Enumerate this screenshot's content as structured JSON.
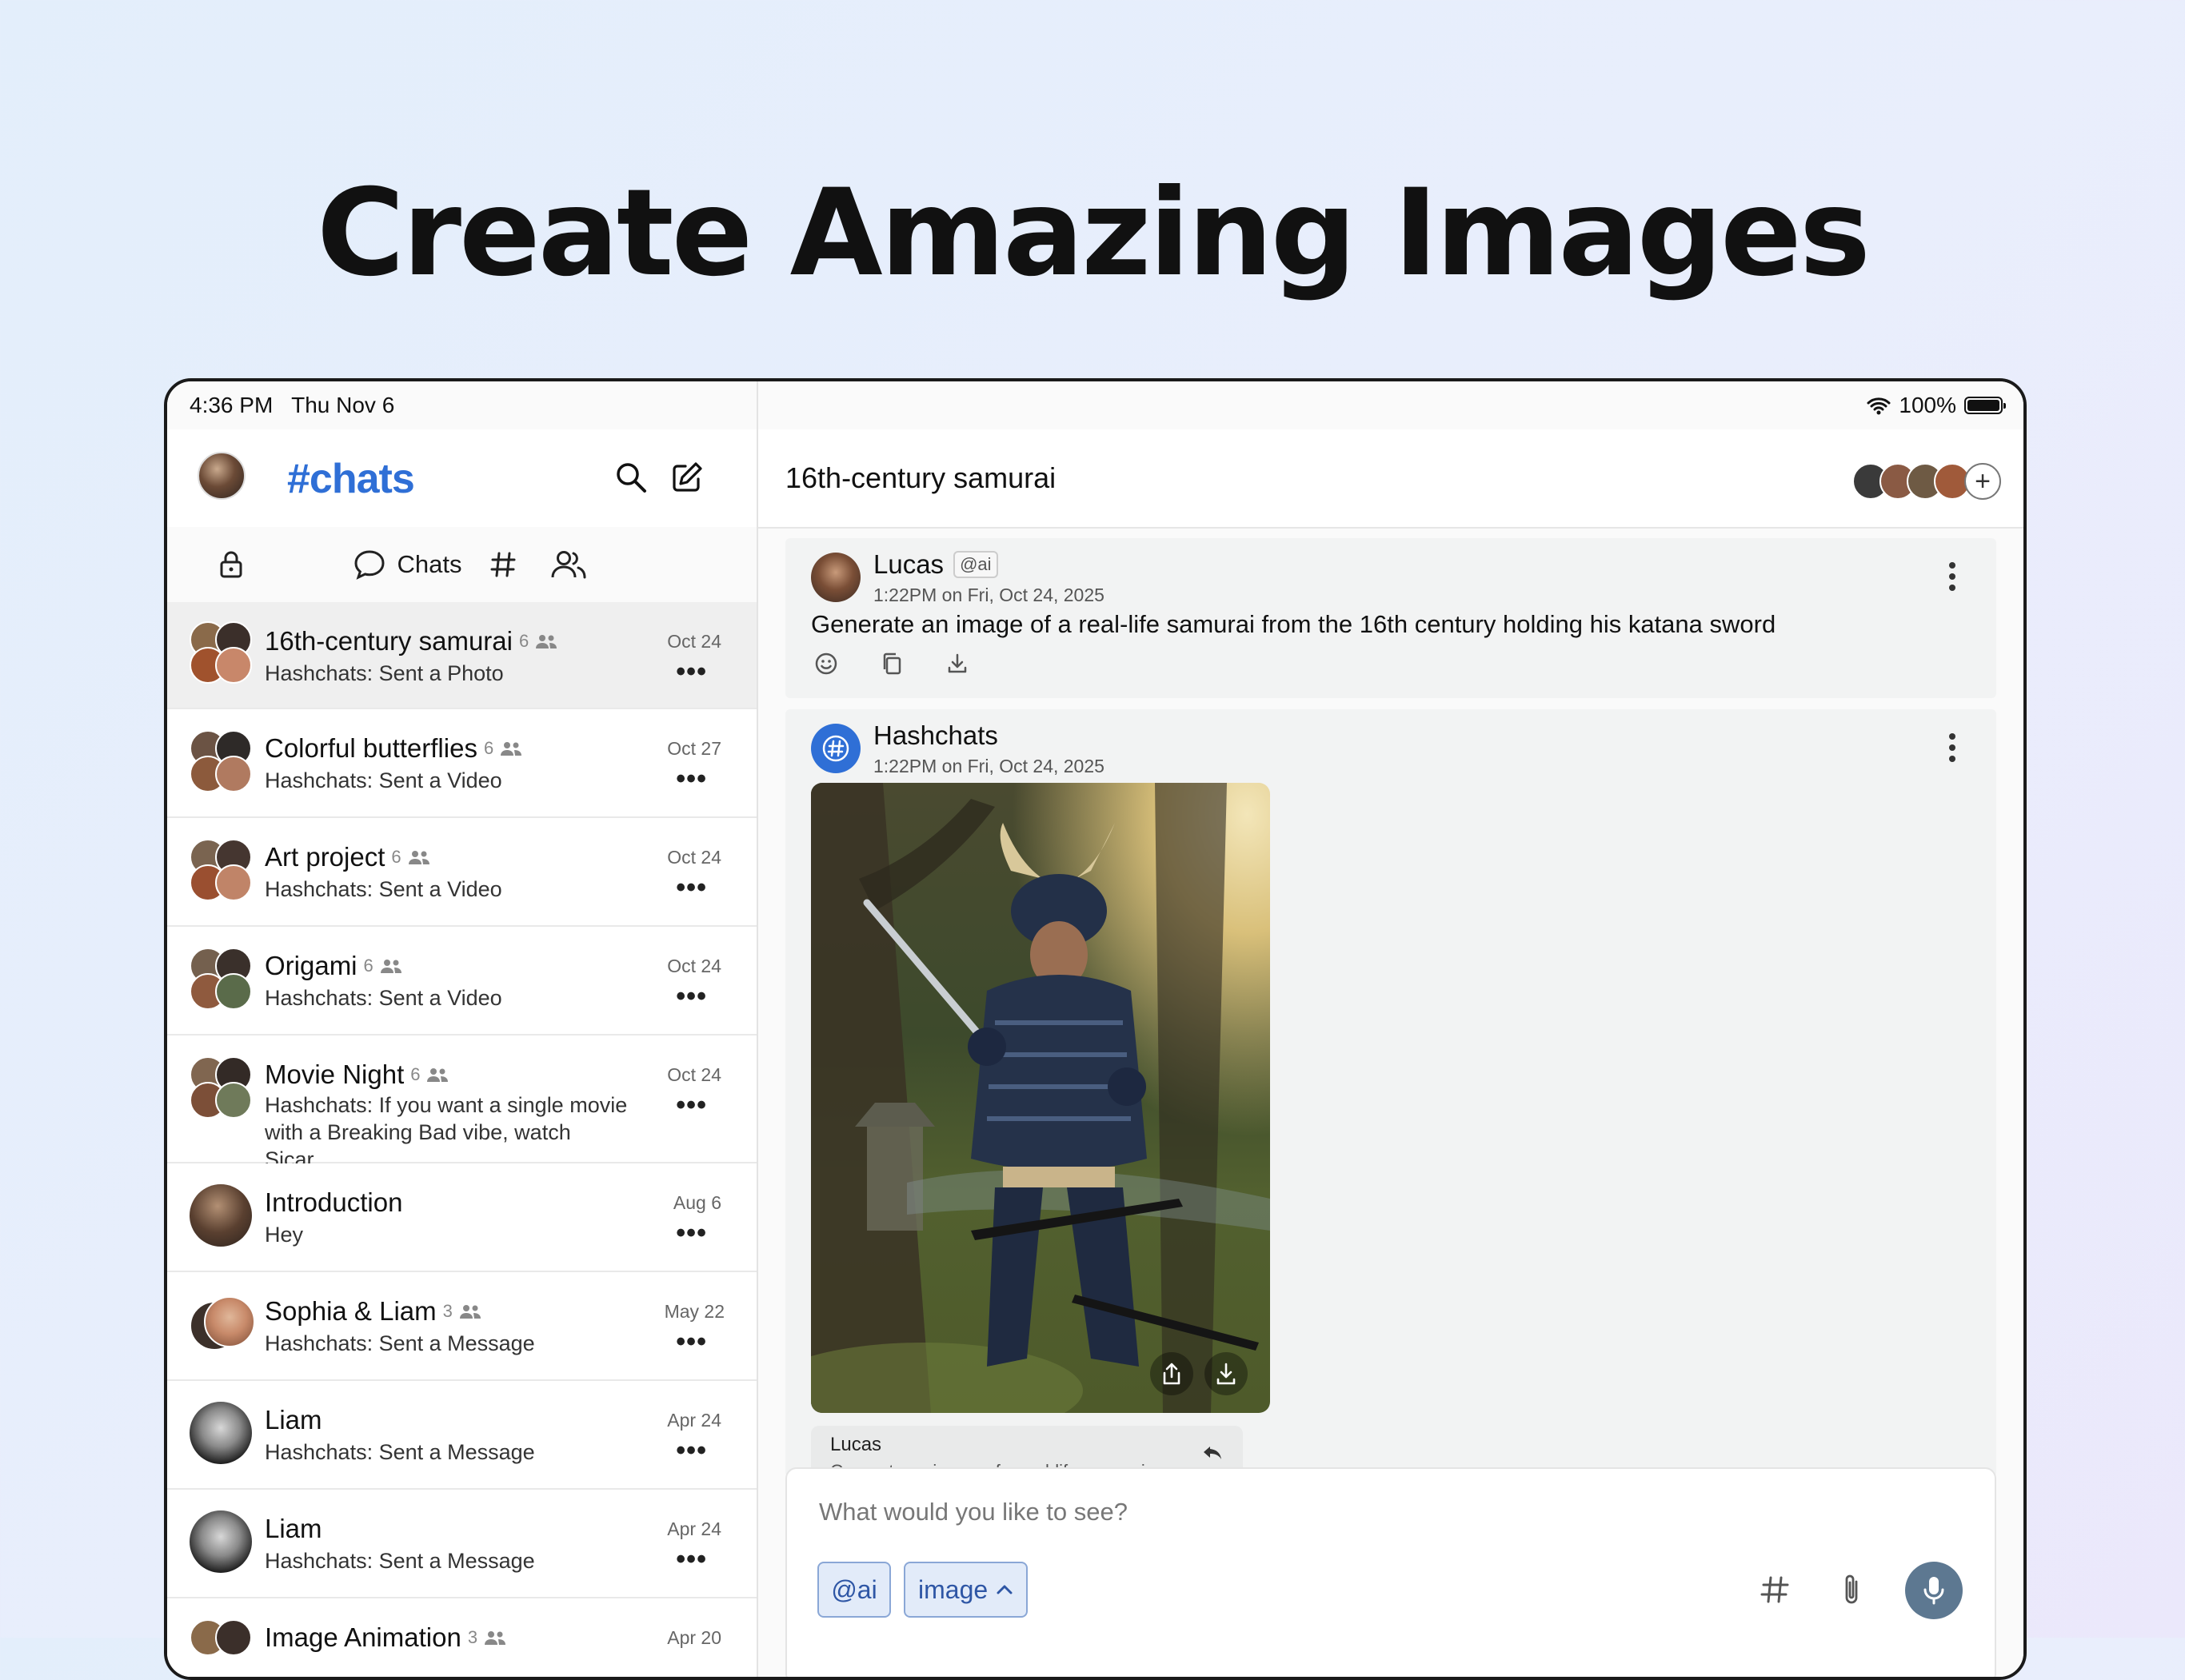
{
  "headline": "Create Amazing Images",
  "status_bar": {
    "time": "4:36 PM   Thu Nov 6",
    "battery": "100%"
  },
  "sidebar": {
    "app_title": "#chats",
    "tabs": {
      "chats_label": "Chats"
    },
    "chats": [
      {
        "title": "16th-century samurai",
        "count": "6",
        "subtitle": "Hashchats: Sent a Photo",
        "date": "Oct 24"
      },
      {
        "title": "Colorful butterflies",
        "count": "6",
        "subtitle": "Hashchats: Sent a Video",
        "date": "Oct 27"
      },
      {
        "title": "Art project",
        "count": "6",
        "subtitle": "Hashchats: Sent a Video",
        "date": "Oct 24"
      },
      {
        "title": "Origami",
        "count": "6",
        "subtitle": "Hashchats: Sent a Video",
        "date": "Oct 24"
      },
      {
        "title": "Movie Night",
        "count": "6",
        "subtitle": "Hashchats: If you want a single movie with a Breaking Bad vibe, watch Sicar…",
        "date": "Oct 24"
      },
      {
        "title": "Introduction",
        "count": "",
        "subtitle": "Hey",
        "date": "Aug 6"
      },
      {
        "title": "Sophia & Liam",
        "count": "3",
        "subtitle": "Hashchats: Sent a Message",
        "date": "May 22"
      },
      {
        "title": "Liam",
        "count": "",
        "subtitle": "Hashchats: Sent a Message",
        "date": "Apr 24"
      },
      {
        "title": "Liam",
        "count": "",
        "subtitle": "Hashchats: Sent a Message",
        "date": "Apr 24"
      },
      {
        "title": "Image Animation",
        "count": "3",
        "subtitle": "",
        "date": "Apr 20"
      }
    ],
    "more_label": "•••"
  },
  "main": {
    "chat_title": "16th-century samurai",
    "add_member_label": "+",
    "messages": [
      {
        "author": "Lucas",
        "badge": "@ai",
        "time": "1:22PM on Fri, Oct 24, 2025",
        "text": "Generate an image of a real-life samurai from the 16th century holding his katana sword"
      },
      {
        "author": "Hashchats",
        "time": "1:22PM on Fri, Oct 24, 2025",
        "reply_name": "Lucas",
        "reply_text": "Generate an image of a real-life samurai"
      }
    ],
    "composer": {
      "placeholder": "What would you like to see?",
      "chip_ai": "@ai",
      "chip_mode": "image"
    }
  },
  "colors": {
    "accent": "#2f6fd6",
    "mic": "#5d7891",
    "chip_bg": "#e2ebf9"
  }
}
